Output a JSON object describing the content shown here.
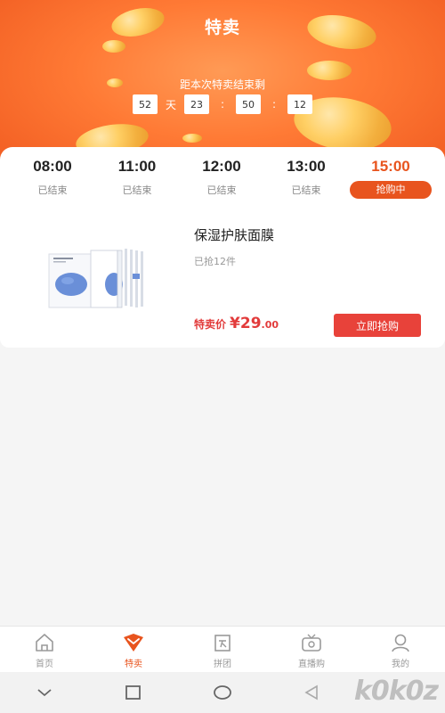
{
  "header": {
    "title": "特卖",
    "countdown_label": "距本次特卖结束剩",
    "countdown": {
      "days": "52",
      "day_unit": "天",
      "hours": "23",
      "minutes": "50",
      "seconds": "12",
      "sep": ":"
    }
  },
  "tabs": [
    {
      "time": "08:00",
      "status": "已结束",
      "active": false
    },
    {
      "time": "11:00",
      "status": "已结束",
      "active": false
    },
    {
      "time": "12:00",
      "status": "已结束",
      "active": false
    },
    {
      "time": "13:00",
      "status": "已结束",
      "active": false
    },
    {
      "time": "15:00",
      "status": "抢购中",
      "active": true
    }
  ],
  "product": {
    "name": "保湿护肤面膜",
    "sold": "已抢12件",
    "price_label": "特卖价",
    "price_currency": "¥",
    "price_int": "29",
    "price_dec": ".00",
    "buy_label": "立即抢购"
  },
  "bottom_nav": [
    {
      "label": "首页",
      "icon": "home-icon",
      "active": false
    },
    {
      "label": "特卖",
      "icon": "flash-sale-icon",
      "active": true
    },
    {
      "label": "拼团",
      "icon": "group-buy-icon",
      "active": false
    },
    {
      "label": "直播购",
      "icon": "live-tv-icon",
      "active": false
    },
    {
      "label": "我的",
      "icon": "profile-icon",
      "active": false
    }
  ],
  "watermark": "k0k0z",
  "colors": {
    "accent": "#e8541e",
    "hero": "#ff7a35",
    "buy": "#e8423a",
    "price": "#e23b3b"
  }
}
